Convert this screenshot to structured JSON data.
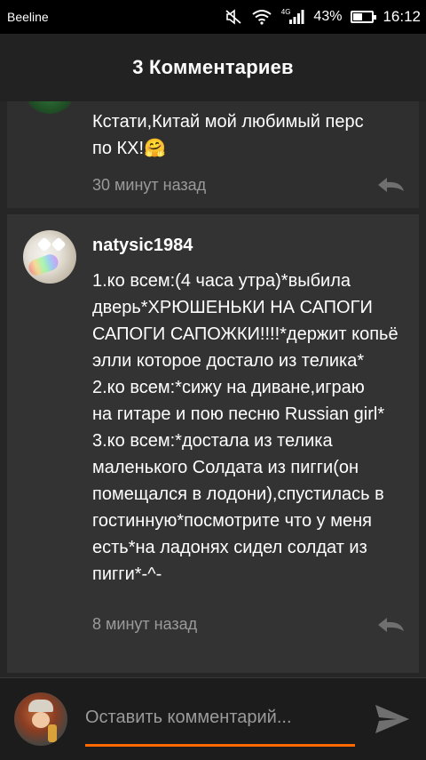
{
  "status_bar": {
    "carrier": "Beeline",
    "network_type": "4G",
    "battery_percent_text": "43%",
    "battery_level": 0.43,
    "time": "16:12"
  },
  "header": {
    "title": "3 Комментариев"
  },
  "comments": [
    {
      "text": "Кстати,Китай мой любимый перс\nпо КХ!🤗",
      "time": "30 минут назад"
    },
    {
      "username": "natysic1984",
      "text": "1.ко всем:(4 часа утра)*выбила\nдверь*ХРЮШЕНЬКИ НА САПОГИ\nСАПОГИ САПОЖКИ!!!!*держит копьё\nэлли которое достало из телика*\n2.ко всем:*сижу на диване,играю\nна гитаре и пою песню Russian girl*\n3.ко всем:*достала из телика\nмаленького Солдата из пигги(он\nпомещался в лодони),спустилась в\nгостинную*посмотрите что у меня\nесть*на ладонях сидел солдат из\nпигги*-^-",
      "time": "8 минут назад"
    }
  ],
  "composer": {
    "placeholder": "Оставить комментарий..."
  },
  "icons": {
    "mute": "mute-icon",
    "wifi": "wifi-icon",
    "signal": "signal-icon",
    "battery": "battery-icon",
    "reply": "reply-icon",
    "send": "send-icon"
  },
  "colors": {
    "accent": "#ff6a00",
    "background": "#222222",
    "card": "#333333",
    "muted_text": "#9a9a9a"
  }
}
